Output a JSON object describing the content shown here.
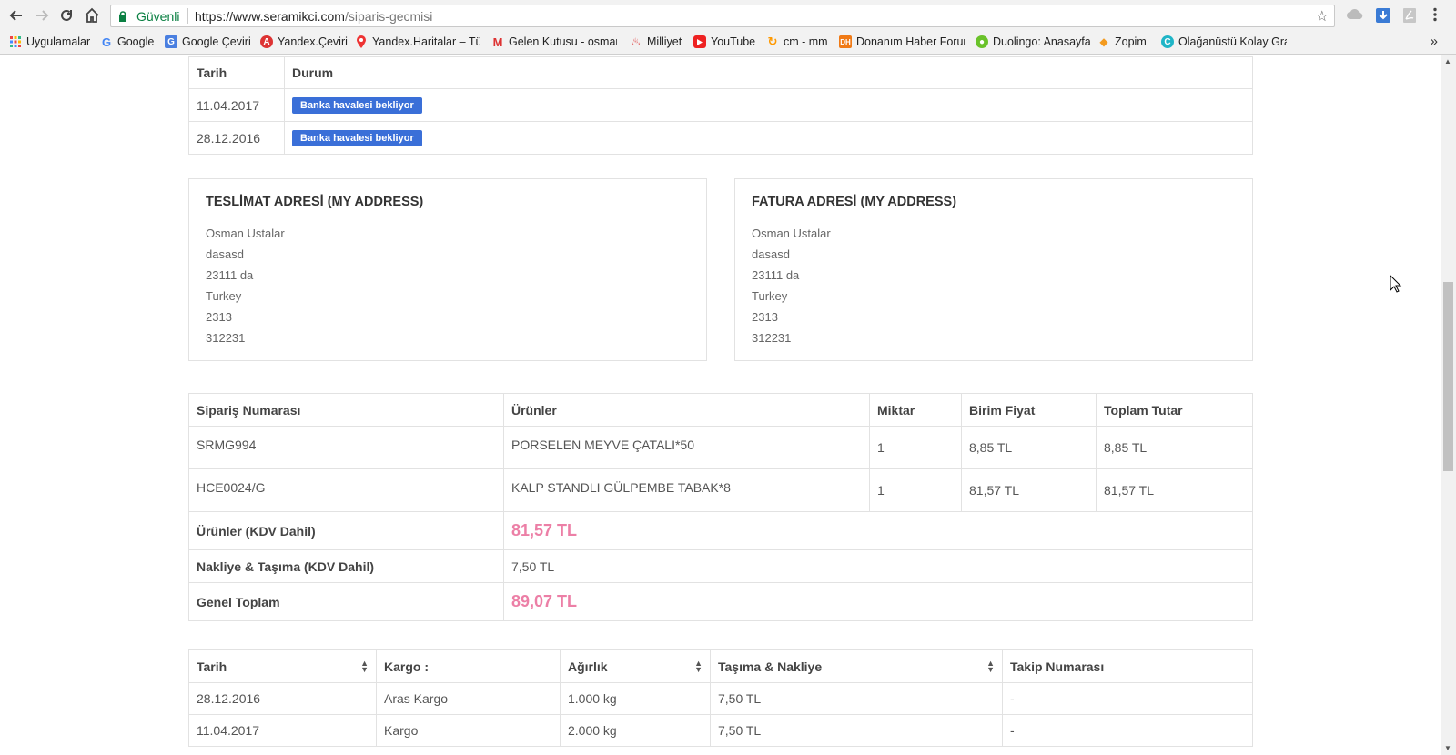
{
  "browser": {
    "security_label": "Güvenli",
    "url_host": "https://www.seramikci.com",
    "url_path": "/siparis-gecmisi",
    "bookmarks": [
      {
        "label": "Uygulamalar",
        "icon": "apps-grid-icon"
      },
      {
        "label": "Google",
        "icon": "google-icon"
      },
      {
        "label": "Google Çeviri",
        "icon": "translate-icon"
      },
      {
        "label": "Yandex.Çeviri",
        "icon": "yandex-translate-icon"
      },
      {
        "label": "Yandex.Haritalar – Tür",
        "icon": "map-pin-icon"
      },
      {
        "label": "Gelen Kutusu - osman",
        "icon": "gmail-icon"
      },
      {
        "label": "Milliyet",
        "icon": "milliyet-icon"
      },
      {
        "label": "YouTube",
        "icon": "youtube-icon"
      },
      {
        "label": "cm - mm",
        "icon": "convert-icon"
      },
      {
        "label": "Donanım Haber Forun",
        "icon": "dh-icon"
      },
      {
        "label": "Duolingo: Anasayfa",
        "icon": "duolingo-icon"
      },
      {
        "label": "Zopim",
        "icon": "zopim-icon"
      },
      {
        "label": "Olağanüstü Kolay Gra",
        "icon": "canva-icon"
      }
    ],
    "overflow_label": "»"
  },
  "status_table": {
    "headers": {
      "date": "Tarih",
      "status": "Durum"
    },
    "rows": [
      {
        "date": "11.04.2017",
        "status": "Banka havalesi bekliyor"
      },
      {
        "date": "28.12.2016",
        "status": "Banka havalesi bekliyor"
      }
    ],
    "badge_color": "#3a6fd8"
  },
  "shipping_address": {
    "title": "TESLİMAT ADRESİ (MY ADDRESS)",
    "lines": [
      "Osman Ustalar",
      "dasasd",
      "23111 da",
      "Turkey",
      "2313",
      "312231"
    ]
  },
  "billing_address": {
    "title": "FATURA ADRESİ (MY ADDRESS)",
    "lines": [
      "Osman Ustalar",
      "dasasd",
      "23111 da",
      "Turkey",
      "2313",
      "312231"
    ]
  },
  "order_table": {
    "headers": {
      "order_no": "Sipariş Numarası",
      "products": "Ürünler",
      "qty": "Miktar",
      "unit_price": "Birim Fiyat",
      "total": "Toplam Tutar"
    },
    "rows": [
      {
        "order_no": "SRMG994",
        "product": "PORSELEN MEYVE ÇATALI*50",
        "qty": "1",
        "unit_price": "8,85 TL",
        "total": "8,85 TL"
      },
      {
        "order_no": "HCE0024/G",
        "product": "KALP STANDLI GÜLPEMBE TABAK*8",
        "qty": "1",
        "unit_price": "81,57 TL",
        "total": "81,57 TL"
      }
    ],
    "summary": {
      "products_label": "Ürünler (KDV Dahil)",
      "products_value": "81,57 TL",
      "shipping_label": "Nakliye & Taşıma (KDV Dahil)",
      "shipping_value": "7,50 TL",
      "grand_label": "Genel Toplam",
      "grand_value": "89,07 TL"
    },
    "accent_color": "#ec7fa6"
  },
  "shipment_table": {
    "headers": {
      "date": "Tarih",
      "carrier": "Kargo :",
      "weight": "Ağırlık",
      "shipping": "Taşıma & Nakliye",
      "tracking": "Takip Numarası"
    },
    "rows": [
      {
        "date": "28.12.2016",
        "carrier": "Aras Kargo",
        "weight": "1.000 kg",
        "shipping": "7,50 TL",
        "tracking": "-"
      },
      {
        "date": "11.04.2017",
        "carrier": "Kargo",
        "weight": "2.000 kg",
        "shipping": "7,50 TL",
        "tracking": "-"
      }
    ]
  }
}
